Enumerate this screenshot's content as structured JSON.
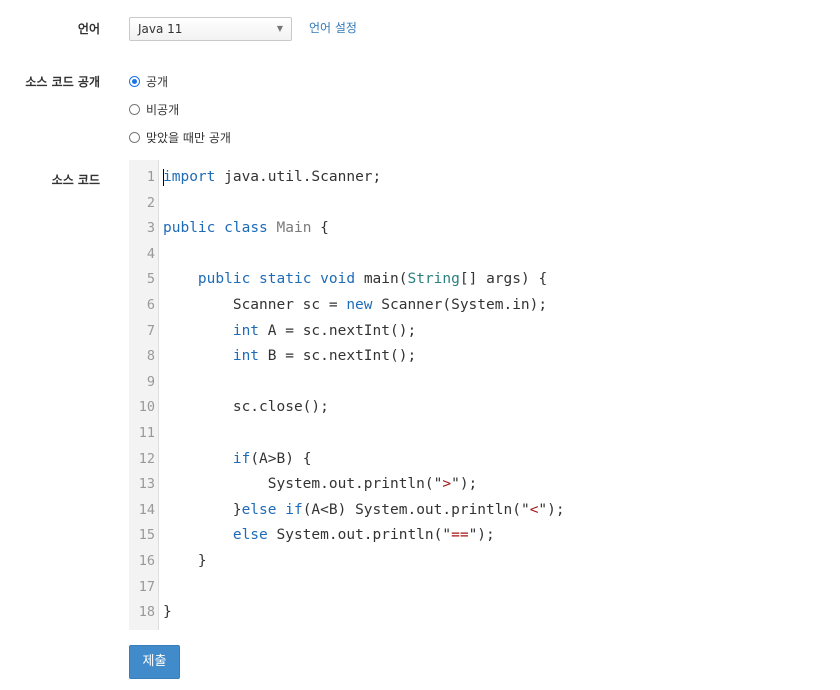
{
  "language": {
    "label": "언어",
    "selected": "Java 11",
    "settings_link": "언어 설정"
  },
  "visibility": {
    "label": "소스 코드 공개",
    "options": [
      {
        "label": "공개",
        "checked": true
      },
      {
        "label": "비공개",
        "checked": false
      },
      {
        "label": "맞았을 때만 공개",
        "checked": false
      }
    ]
  },
  "source": {
    "label": "소스 코드",
    "lines": [
      {
        "num": "1",
        "text": "import java.util.Scanner;"
      },
      {
        "num": "2",
        "text": ""
      },
      {
        "num": "3",
        "text": "public class Main {"
      },
      {
        "num": "4",
        "text": ""
      },
      {
        "num": "5",
        "text": "    public static void main(String[] args) {"
      },
      {
        "num": "6",
        "text": "        Scanner sc = new Scanner(System.in);"
      },
      {
        "num": "7",
        "text": "        int A = sc.nextInt();"
      },
      {
        "num": "8",
        "text": "        int B = sc.nextInt();"
      },
      {
        "num": "9",
        "text": ""
      },
      {
        "num": "10",
        "text": "        sc.close();"
      },
      {
        "num": "11",
        "text": ""
      },
      {
        "num": "12",
        "text": "        if(A>B) {"
      },
      {
        "num": "13",
        "text": "            System.out.println(\">\");"
      },
      {
        "num": "14",
        "text": "        }else if(A<B) System.out.println(\"<\");"
      },
      {
        "num": "15",
        "text": "        else System.out.println(\"==\");"
      },
      {
        "num": "16",
        "text": "    }"
      },
      {
        "num": "17",
        "text": ""
      },
      {
        "num": "18",
        "text": "}"
      }
    ]
  },
  "submit": {
    "label": "제출"
  },
  "colors": {
    "accent": "#428bca",
    "link": "#337ab7",
    "keyword": "#1e6bb8",
    "string": "#a31515"
  }
}
